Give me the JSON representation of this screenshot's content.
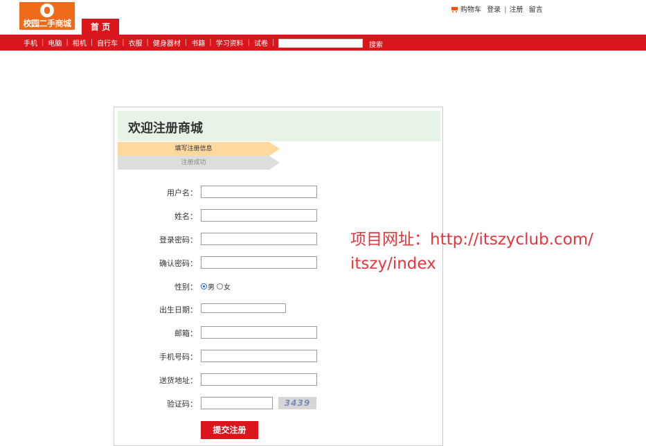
{
  "logo": {
    "text": "校园二手商城"
  },
  "home_tab": "首 页",
  "toplinks": {
    "cart": "购物车",
    "login": "登录",
    "sep": "|",
    "register": "注册",
    "message": "留言"
  },
  "nav": {
    "items": [
      "手机",
      "电脑",
      "相机",
      "自行车",
      "衣服",
      "健身器材",
      "书籍",
      "学习资料",
      "试卷"
    ],
    "search_value": "",
    "search_button": "搜索"
  },
  "form": {
    "title": "欢迎注册商城",
    "steps": [
      "填写注册信息",
      "注册成功"
    ],
    "fields": [
      {
        "label": "用户名：",
        "value": ""
      },
      {
        "label": "姓名：",
        "value": ""
      },
      {
        "label": "登录密码：",
        "value": ""
      },
      {
        "label": "确认密码：",
        "value": ""
      }
    ],
    "gender": {
      "label": "性别：",
      "options": [
        "男",
        "女"
      ],
      "selected": "男"
    },
    "birth": {
      "label": "出生日期：",
      "value": ""
    },
    "fields2": [
      {
        "label": "邮箱：",
        "value": ""
      },
      {
        "label": "手机号码：",
        "value": ""
      },
      {
        "label": "送货地址：",
        "value": ""
      }
    ],
    "captcha": {
      "label": "验证码：",
      "value": "",
      "image_text": "3439"
    },
    "submit": "提交注册"
  },
  "watermark": {
    "line1": "项目网址：http://itszyclub.com/",
    "line2": "itszy/index"
  },
  "colors": {
    "brand_red": "#d9161c",
    "logo_orange": "#ef6a1a",
    "step_active": "#ffd89e",
    "welcome_bg": "#e6f3e6"
  }
}
